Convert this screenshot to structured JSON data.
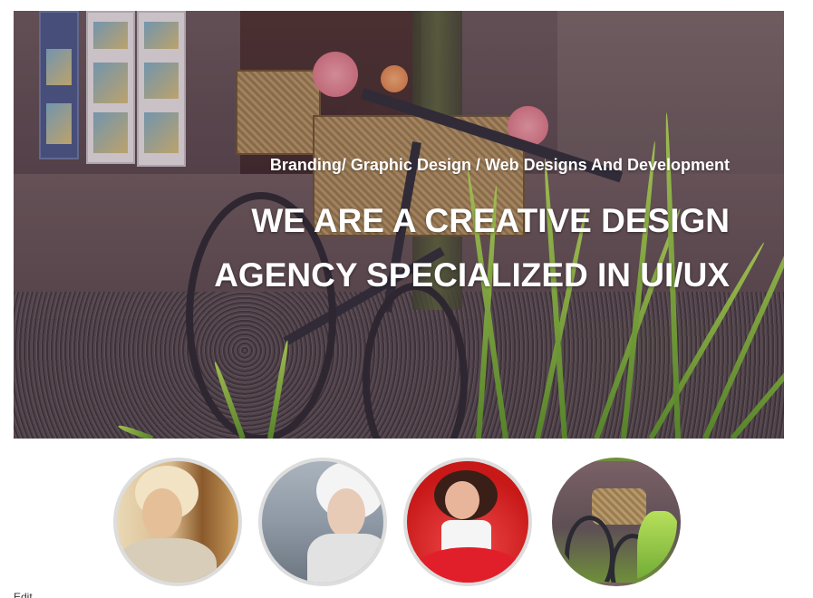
{
  "hero": {
    "tagline": "Branding/ Graphic Design / Web Designs And Development",
    "headline_line1": "WE ARE A CREATIVE DESIGN",
    "headline_line2": "AGENCY SPECIALIZED IN UI/UX"
  },
  "thumbnails": [
    {
      "name": "blonde-woman-portrait"
    },
    {
      "name": "white-haired-woman-portrait"
    },
    {
      "name": "woman-in-red-dress"
    },
    {
      "name": "bicycle-with-basket"
    }
  ],
  "caption": "Edit"
}
